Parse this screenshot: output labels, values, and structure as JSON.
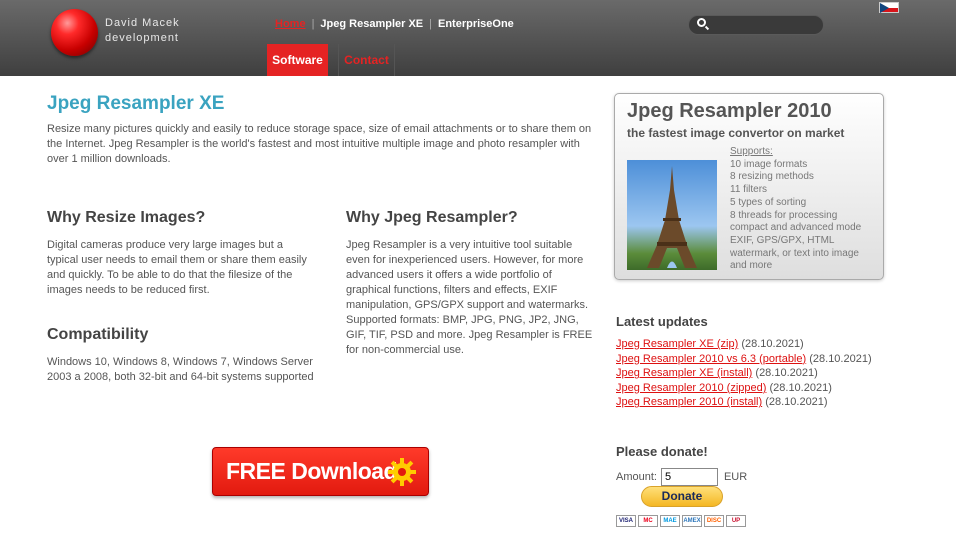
{
  "brand": {
    "line1": "David Macek",
    "line2": "development"
  },
  "topnav": [
    "Home",
    "Jpeg Resampler XE",
    "EnterpriseOne"
  ],
  "tabs": {
    "software": "Software",
    "contact": "Contact"
  },
  "main": {
    "title": "Jpeg Resampler XE",
    "intro": "Resize many pictures quickly and easily to reduce storage space, size of email attachments or to share them on the Internet. Jpeg Resampler is the world's fastest and most intuitive multiple image and photo resampler with over 1 million downloads.",
    "why_resize": {
      "heading": "Why Resize Images?",
      "text": "Digital cameras produce very large images but a typical user needs to email them or share them easily and quickly. To be able to do that the filesize of the images needs to be reduced first."
    },
    "why_jpeg": {
      "heading": "Why Jpeg Resampler?",
      "text": "Jpeg Resampler is a very intuitive tool suitable even for inexperienced users. However, for more advanced users it offers a wide portfolio of graphical functions, filters and effects, EXIF manipulation, GPS/GPX support and watermarks. Supported formats: BMP, JPG, PNG, JP2, JNG, GIF, TIF, PSD and more. Jpeg Resampler is FREE for non-commercial use."
    },
    "compat": {
      "heading": "Compatibility",
      "text": "Windows 10, Windows 8, Windows 7, Windows Server 2003 a 2008, both 32-bit and 64-bit systems supported"
    },
    "download_label": "FREE Download"
  },
  "promo": {
    "title": "Jpeg Resampler 2010",
    "subtitle": "the fastest image convertor on market",
    "supports_head": "Supports:",
    "features": [
      "10 image formats",
      "8 resizing methods",
      "11 filters",
      "5 types of sorting",
      "8 threads for processing",
      "compact and advanced mode",
      "EXIF, GPS/GPX, HTML",
      "watermark, or text into image",
      "and more"
    ]
  },
  "updates": {
    "heading": "Latest updates",
    "items": [
      {
        "link": "Jpeg Resampler XE (zip)",
        "date": "(28.10.2021)"
      },
      {
        "link": "Jpeg Resampler 2010 vs 6.3 (portable)",
        "date": "(28.10.2021)"
      },
      {
        "link": "Jpeg Resampler XE (install)",
        "date": "(28.10.2021)"
      },
      {
        "link": "Jpeg Resampler 2010 (zipped)",
        "date": "(28.10.2021)"
      },
      {
        "link": "Jpeg Resampler 2010 (install)",
        "date": "(28.10.2021)"
      }
    ]
  },
  "donate": {
    "heading": "Please donate!",
    "amount_label": "Amount:",
    "amount_value": "5",
    "currency": "EUR",
    "button": "Donate",
    "cards": [
      "VISA",
      "MC",
      "MAE",
      "AMEX",
      "DISC",
      "UP"
    ]
  }
}
